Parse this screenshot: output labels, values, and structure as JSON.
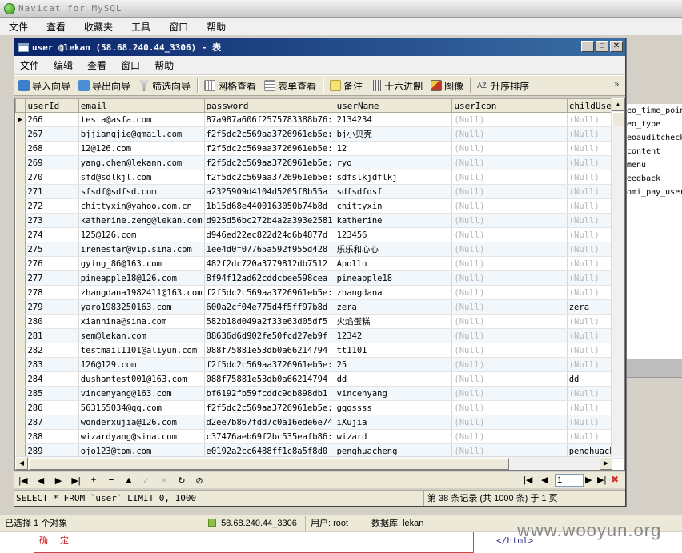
{
  "outer": {
    "title": "Navicat for MySQL",
    "menu": [
      "文件",
      "查看",
      "收藏夹",
      "工具",
      "窗口",
      "帮助"
    ]
  },
  "right_panel": {
    "items": [
      "eo_time_poin",
      "eo_type",
      "eoauditcheck",
      "content",
      "menu",
      "eedback",
      "omi_pay_user"
    ]
  },
  "inner": {
    "title": "user @lekan (58.68.240.44_3306) - 表",
    "menu": [
      "文件",
      "编辑",
      "查看",
      "窗口",
      "帮助"
    ],
    "toolbar": {
      "import": "导入向导",
      "export": "导出向导",
      "filter": "筛选向导",
      "grid_view": "网格查看",
      "form_view": "表单查看",
      "memo": "备注",
      "hex": "十六进制",
      "image": "图像",
      "sort": "升序排序"
    },
    "columns": [
      "userId",
      "email",
      "password",
      "userName",
      "userIcon",
      "childUserI"
    ],
    "rows": [
      [
        "266",
        "testa@asfa.com",
        "87a987a606f2575783388b76:",
        "2134234",
        "(Null)",
        "(Null)"
      ],
      [
        "267",
        "bjjiangjie@gmail.com",
        "f2f5dc2c569aa3726961eb5e:",
        "bj小贝壳",
        "(Null)",
        "(Null)"
      ],
      [
        "268",
        "12@126.com",
        "f2f5dc2c569aa3726961eb5e:",
        "12",
        "(Null)",
        "(Null)"
      ],
      [
        "269",
        "yang.chen@lekann.com",
        "f2f5dc2c569aa3726961eb5e:",
        "ryo",
        "(Null)",
        "(Null)"
      ],
      [
        "270",
        "sfd@sdlkjl.com",
        "f2f5dc2c569aa3726961eb5e:",
        "sdfslkjdflkj",
        "(Null)",
        "(Null)"
      ],
      [
        "271",
        "sfsdf@sdfsd.com",
        "a2325909d4104d5205f8b55a",
        "sdfsdfdsf",
        "(Null)",
        "(Null)"
      ],
      [
        "272",
        "chittyxin@yahoo.com.cn",
        "1b15d68e4400163050b74b8d",
        "chittyxin",
        "(Null)",
        "(Null)"
      ],
      [
        "273",
        "katherine.zeng@lekan.com",
        "d925d56bc272b4a2a393e2581",
        "katherine",
        "(Null)",
        "(Null)"
      ],
      [
        "274",
        "125@126.com",
        "d946ed22ec822d24d6b4877d",
        "123456",
        "(Null)",
        "(Null)"
      ],
      [
        "275",
        "irenestar@vip.sina.com",
        "1ee4d0f07765a592f955d428",
        "乐乐和心心",
        "(Null)",
        "(Null)"
      ],
      [
        "276",
        "gying_86@163.com",
        "482f2dc720a3779812db7512",
        "Apollo",
        "(Null)",
        "(Null)"
      ],
      [
        "277",
        "pineapple18@126.com",
        "8f94f12ad62cddcbee598cea",
        "pineapple18",
        "(Null)",
        "(Null)"
      ],
      [
        "278",
        "zhangdana1982411@163.com",
        "f2f5dc2c569aa3726961eb5e:",
        "zhangdana",
        "(Null)",
        "(Null)"
      ],
      [
        "279",
        "yaro1983250163.com",
        "600a2cf04e775d4f5ff97b8d",
        "zera",
        "(Null)",
        "zera"
      ],
      [
        "280",
        "xiannina@sina.com",
        "582b18d049a2f33e63d05df5",
        "火焰蛋糕",
        "(Null)",
        "(Null)"
      ],
      [
        "281",
        "sem@lekan.com",
        "88636d6d902fe50fcd27eb9f",
        "12342",
        "(Null)",
        "(Null)"
      ],
      [
        "282",
        "testmail1101@aliyun.com",
        "088f75881e53db0a66214794",
        "tt1101",
        "(Null)",
        "(Null)"
      ],
      [
        "283",
        "126@129.com",
        "f2f5dc2c569aa3726961eb5e:",
        "25",
        "(Null)",
        "(Null)"
      ],
      [
        "284",
        "dushantest001@163.com",
        "088f75881e53db0a66214794",
        "dd",
        "(Null)",
        "dd"
      ],
      [
        "285",
        "vincenyang@163.com",
        "bf6192fb59fcddc9db898db1",
        "vincenyang",
        "(Null)",
        "(Null)"
      ],
      [
        "286",
        "563155034@qq.com",
        "f2f5dc2c569aa3726961eb5e:",
        "gqqssss",
        "(Null)",
        "(Null)"
      ],
      [
        "287",
        "wonderxujia@126.com",
        "d2ee7b867fdd7c0a16ede6e74",
        "iXujia",
        "(Null)",
        "(Null)"
      ],
      [
        "288",
        "wizardyang@sina.com",
        "c37476aeb69f2bc535eafb86:",
        "wizard",
        "(Null)",
        "(Null)"
      ],
      [
        "289",
        "ojo123@tom.com",
        "e0192a2cc6488ff1c8a5f8d0",
        "penghuacheng",
        "(Null)",
        "penghuache"
      ]
    ],
    "page_input": "1",
    "status_sql": "SELECT * FROM `user` LIMIT 0, 1000",
    "status_records": "第 38 条记录 (共 1000 条) 于 1 页"
  },
  "outer_status": {
    "selected": "已选择 1 个对象",
    "connection": "58.68.240.44_3306",
    "user": "用户: root",
    "database": "数据库: lekan"
  },
  "behind": {
    "confirm": "确 定",
    "code_line": "</html>"
  },
  "watermark": "www.wooyun.org",
  "colors": {
    "inner_title": "#0a246a",
    "null_text": "#b6b6b6",
    "alt_row": "#f2f7fc"
  }
}
